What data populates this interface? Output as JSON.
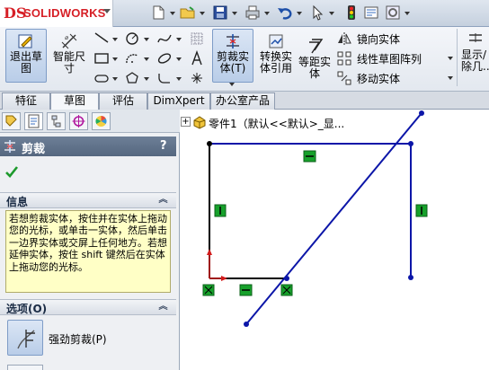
{
  "app": {
    "brand": "SOLIDWORKS",
    "brand_mark": "DS"
  },
  "command_manager": {
    "exit_sketch_label": "退出草\n图",
    "smart_dimension_label": "智能尺\n寸",
    "trim_entities_label": "剪裁实\n体(T)",
    "convert_entities_label": "转换实\n体引用",
    "offset_entities_label": "等距实\n体",
    "mirror_entities_label": "镜向实体",
    "linear_pattern_label": "线性草图阵列",
    "move_entities_label": "移动实体",
    "display_delete_label": "显示/\n除几..."
  },
  "tabs": [
    {
      "label": "特征",
      "active": false
    },
    {
      "label": "草图",
      "active": true
    },
    {
      "label": "评估",
      "active": false
    },
    {
      "label": "DimXpert",
      "active": false
    },
    {
      "label": "办公室产品",
      "active": false
    }
  ],
  "property_manager": {
    "title": "剪裁",
    "help": "?",
    "info_header": "信息",
    "info_text": "若想剪裁实体，按住并在实体上拖动您的光标，或单击一实体，然后单击一边界实体或交屏上任何地方。若想延伸实体，按住 shift 键然后在实体上拖动您的光标。",
    "options_header": "选项(O)",
    "power_trim_label": "强劲剪裁(P)"
  },
  "feature_tree": {
    "root_label": "零件1（默认<<默认>_显..."
  },
  "colors": {
    "sketch_blue": "#0c16a8",
    "sketch_black": "#000000",
    "relation_green": "#17a12b",
    "origin_red": "#d21b1b",
    "panel_header": "#5e708a",
    "info_bg": "#ffffc6"
  }
}
